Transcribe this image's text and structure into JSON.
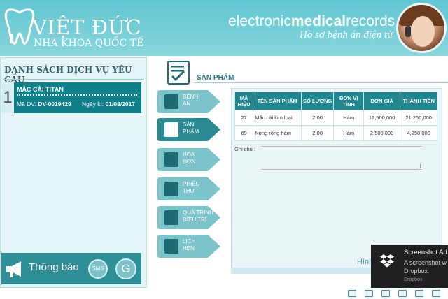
{
  "header": {
    "logo_name": "VIỆT ĐỨC",
    "logo_subtitle": "NHA KHOA QUỐC TẾ",
    "brand_prefix": "electronic",
    "brand_bold": "medical",
    "brand_suffix": "records",
    "tagline": "Hồ sơ bệnh án điện tử"
  },
  "sidebar": {
    "title": "DANH SÁCH DỊCH VỤ YÊU CẦU",
    "requests": [
      {
        "index": "1",
        "name": "MẮC CÀI TITAN",
        "code_label": "Mã DV:",
        "code": "DV-0019429",
        "date_label": "Ngày kí:",
        "date": "01/08/2017"
      }
    ],
    "notify_label": "Thông báo",
    "sms_label": "SMS",
    "g_label": "G"
  },
  "main": {
    "title": "SẢN PHẨM",
    "tabs": [
      {
        "line1": "BỆNH",
        "line2": "ÁN",
        "active": false
      },
      {
        "line1": "SẢN",
        "line2": "PHẨM",
        "active": true
      },
      {
        "line1": "HÓA",
        "line2": "ĐƠN",
        "active": false
      },
      {
        "line1": "PHIẾU",
        "line2": "THU",
        "active": false
      },
      {
        "line1": "QUÁ TRÌNH",
        "line2": "ĐIỀU TRỊ",
        "active": false
      },
      {
        "line1": "LỊCH",
        "line2": "HẸN",
        "active": false
      }
    ],
    "table": {
      "headers": [
        "MÃ HIỆU",
        "TÊN SẢN PHẨM",
        "SỐ LƯỢNG",
        "ĐƠN VỊ TÍNH",
        "ĐƠN GIÁ",
        "THÀNH TIỀN"
      ],
      "rows": [
        [
          "27",
          "Mắc cài kim loại",
          "2.00",
          "Hàm",
          "12,500,000",
          "21,250,000"
        ],
        [
          "69",
          "Nong rộng hàm",
          "2.00",
          "Hàm",
          "2,500,000",
          "4,250,000"
        ]
      ]
    },
    "note_label": "Ghi chú :",
    "hinh_link": "Hình"
  },
  "toast": {
    "title": "Screenshot Ad",
    "body_line1": "A screenshot w",
    "body_line2": "Dropbox.",
    "source": "Dropbox"
  },
  "colors": {
    "header_teal": "#5fc6d1",
    "dark_teal": "#0f7f8a",
    "table_header": "#208690"
  }
}
